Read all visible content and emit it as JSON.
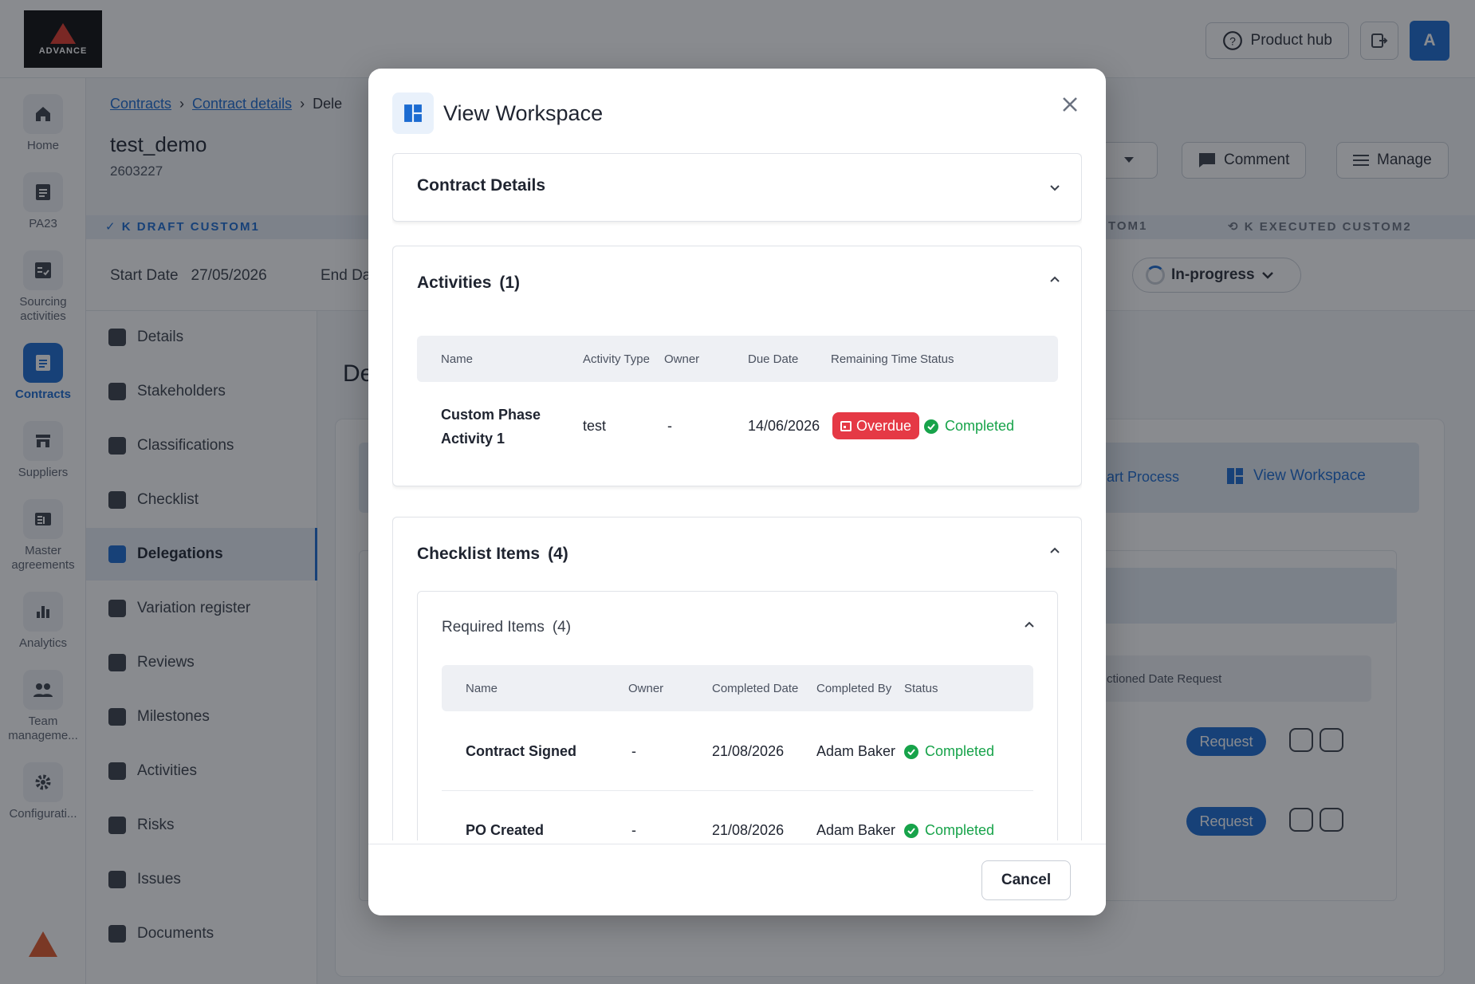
{
  "app": {
    "logo_text": "ADVANCE"
  },
  "topbar": {
    "product_hub": "Product hub",
    "avatar_initial": "A"
  },
  "rail": {
    "items": [
      {
        "label": "Home",
        "icon": "home-icon"
      },
      {
        "label": "PA23",
        "icon": "document-icon"
      },
      {
        "label": "Sourcing activities",
        "icon": "checklist-icon"
      },
      {
        "label": "Contracts",
        "icon": "contract-icon"
      },
      {
        "label": "Suppliers",
        "icon": "store-icon"
      },
      {
        "label": "Master agreements",
        "icon": "agreement-icon"
      },
      {
        "label": "Analytics",
        "icon": "bar-chart-icon"
      },
      {
        "label": "Team manageme...",
        "icon": "team-icon"
      },
      {
        "label": "Configurati...",
        "icon": "gear-icon"
      }
    ]
  },
  "breadcrumb": {
    "contracts": "Contracts",
    "contract_details": "Contract details",
    "current": "Dele"
  },
  "contract": {
    "name": "test_demo",
    "number": "2603227"
  },
  "stages": {
    "left": "K DRAFT CUSTOM1",
    "mid": "TOM1",
    "right": "K EXECUTED CUSTOM2"
  },
  "dates": {
    "start_label": "Start Date",
    "start_value": "27/05/2026",
    "end_label": "End Da"
  },
  "header_buttons": {
    "comment": "Comment",
    "manage": "Manage",
    "status": "In-progress"
  },
  "subnav": {
    "items": [
      "Details",
      "Stakeholders",
      "Classifications",
      "Checklist",
      "Delegations",
      "Variation register",
      "Reviews",
      "Milestones",
      "Activities",
      "Risks",
      "Issues",
      "Documents"
    ]
  },
  "background": {
    "heading": "De",
    "start_process": "art Process",
    "view_workspace": "View Workspace",
    "table_head": "ctioned Date Request",
    "request": "Request"
  },
  "modal": {
    "title": "View Workspace",
    "contract_details": "Contract Details",
    "activities": {
      "title": "Activities",
      "count": "(1)",
      "columns": [
        "Name",
        "Activity Type",
        "Owner",
        "Due Date",
        "Remaining Time",
        "Status"
      ],
      "rows": [
        {
          "name_line1": "Custom Phase",
          "name_line2": "Activity 1",
          "type": "test",
          "owner": "-",
          "due": "14/06/2026",
          "remaining": "Overdue",
          "status": "Completed"
        }
      ]
    },
    "checklist": {
      "title": "Checklist Items",
      "count": "(4)",
      "required": {
        "title": "Required Items",
        "count": "(4)"
      },
      "columns": [
        "Name",
        "Owner",
        "Completed Date",
        "Completed By",
        "Status"
      ],
      "rows": [
        {
          "name": "Contract Signed",
          "owner": "-",
          "date": "21/08/2026",
          "by": "Adam Baker",
          "status": "Completed"
        },
        {
          "name": "PO Created",
          "owner": "-",
          "date": "21/08/2026",
          "by": "Adam Baker",
          "status": "Completed"
        }
      ]
    },
    "cancel": "Cancel"
  },
  "colors": {
    "primary": "#1b6bd1",
    "danger": "#e53945",
    "success": "#17a34a"
  }
}
